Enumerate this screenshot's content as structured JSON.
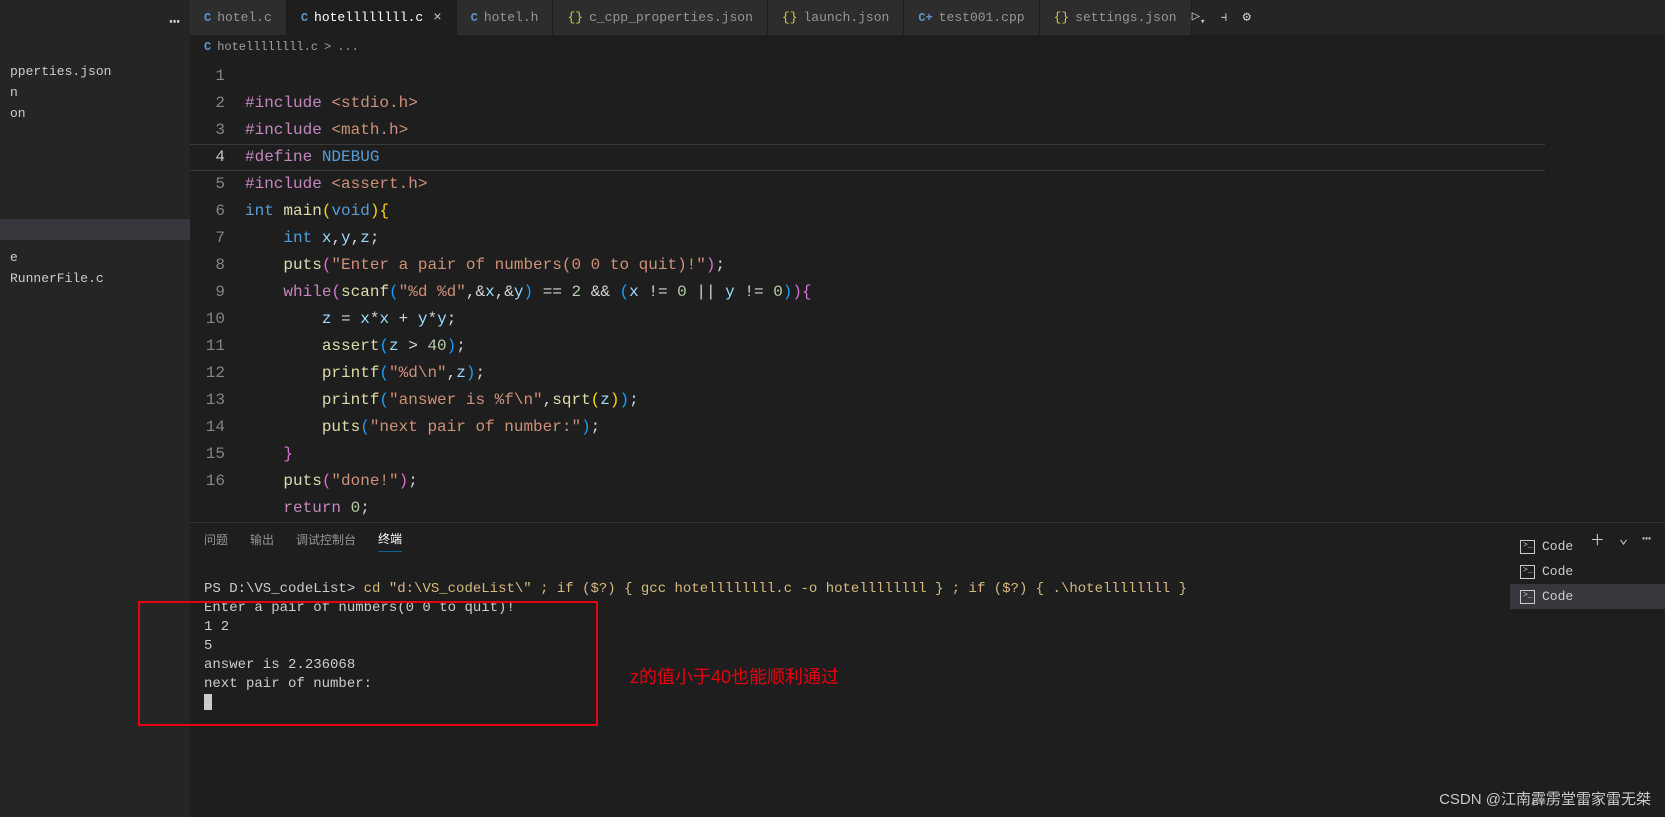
{
  "tabs": [
    {
      "icon": "C",
      "label": "hotel.c"
    },
    {
      "icon": "C",
      "label": "hotellllllll.c",
      "active": true
    },
    {
      "icon": "C",
      "label": "hotel.h"
    },
    {
      "icon": "{}",
      "label": "c_cpp_properties.json"
    },
    {
      "icon": "{}",
      "label": "launch.json"
    },
    {
      "icon": "C+",
      "label": "test001.cpp"
    },
    {
      "icon": "{}",
      "label": "settings.json"
    }
  ],
  "breadcrumb": {
    "icon": "C",
    "file": "hotellllllll.c",
    "sep": ">",
    "more": "..."
  },
  "explorer": {
    "items": [
      "pperties.json",
      "n",
      "on",
      "",
      "",
      "e",
      "RunnerFile.c"
    ]
  },
  "line_numbers": [
    "1",
    "2",
    "3",
    "4",
    "5",
    "6",
    "7",
    "8",
    "9",
    "10",
    "11",
    "12",
    "13",
    "14",
    "15",
    "16"
  ],
  "panel": {
    "tabs": [
      "问题",
      "输出",
      "调试控制台",
      "终端"
    ],
    "active_tab": "终端"
  },
  "terminal": {
    "prompt_prefix": "PS D:\\VS_codeList> ",
    "cmd_part1": "cd \"d:\\VS_codeList\\\"",
    "cmd_part2": " ; if ($?) { gcc hotellllllll.c -o hotellllllll } ; if ($?) { .\\hotellllllll }",
    "out1": "Enter a pair of numbers(0 0 to quit)!",
    "out2": "1 2",
    "out3": "5",
    "out4": "answer is 2.236068",
    "out5": "next pair of number:"
  },
  "annotation": "z的值小于40也能顺利通过",
  "right_items": [
    "Code",
    "Code",
    "Code"
  ],
  "watermark": "CSDN @江南霹雳堂雷家雷无桀",
  "code": {
    "l1": {
      "a": "#include",
      "b": "<stdio.h>"
    },
    "l2": {
      "a": "#include",
      "b": "<math.h>"
    },
    "l3": {
      "a": "#define",
      "b": "NDEBUG"
    },
    "l4": {
      "a": "#include",
      "b": "<assert.h>"
    },
    "l5": {
      "a": "int",
      "b": "main",
      "c": "void"
    },
    "l6": {
      "a": "int",
      "b": "x",
      "c": "y",
      "d": "z"
    },
    "l7": {
      "a": "puts",
      "b": "\"Enter a pair of numbers(0 0 to quit)!\""
    },
    "l8": {
      "a": "while",
      "b": "scanf",
      "c": "\"%d %d\"",
      "d": "x",
      "e": "y",
      "f": "2",
      "g": "x",
      "h": "0",
      "i": "y",
      "j": "0"
    },
    "l9": {
      "a": "z",
      "b": "x",
      "c": "x",
      "d": "y",
      "e": "y"
    },
    "l10": {
      "a": "assert",
      "b": "z",
      "c": "40"
    },
    "l11": {
      "a": "printf",
      "b": "\"%d\\n\"",
      "c": "z"
    },
    "l12": {
      "a": "printf",
      "b": "\"answer is %f\\n\"",
      "c": "sqrt",
      "d": "z"
    },
    "l13": {
      "a": "puts",
      "b": "\"next pair of number:\""
    },
    "l15": {
      "a": "puts",
      "b": "\"done!\""
    },
    "l16": {
      "a": "return",
      "b": "0"
    }
  }
}
